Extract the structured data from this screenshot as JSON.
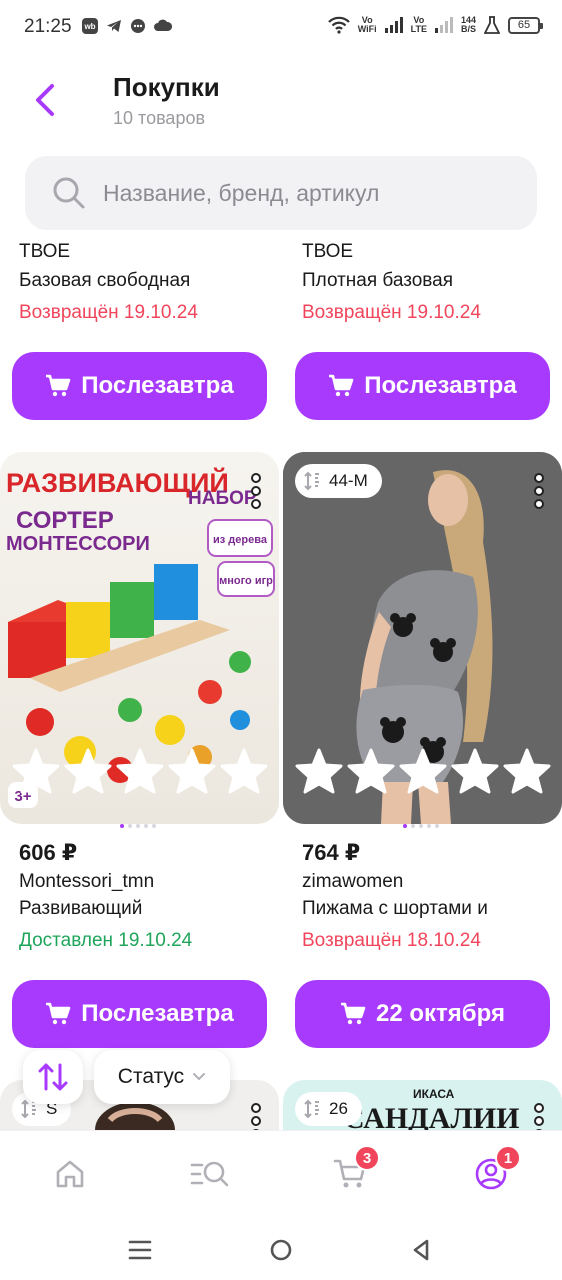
{
  "status_bar": {
    "time": "21:25",
    "apps": [
      "wb",
      "telegram-icon",
      "chat-icon",
      "cloud-icon"
    ],
    "vo_wifi": "Vo\nWiFi",
    "vo_lte": "Vo\nLTE",
    "net_speed_value": "144",
    "net_speed_unit": "B/S",
    "battery": "65"
  },
  "header": {
    "title": "Покупки",
    "subtitle": "10 товаров"
  },
  "search": {
    "placeholder": "Название, бренд, артикул"
  },
  "products": [
    {
      "brand_partial": "ТВОЕ",
      "name": "Базовая свободная",
      "status": "Возвращён 19.10.24",
      "status_type": "returned",
      "button": "Послезавтра"
    },
    {
      "brand_partial": "ТВОЕ",
      "name": "Плотная базовая",
      "status": "Возвращён 19.10.24",
      "status_type": "returned",
      "button": "Послезавтра"
    },
    {
      "image_text": {
        "line1": "РАЗВИВАЮЩИЙ",
        "line2": "НАБОР",
        "line3": "СОРТЕР",
        "line4": "МОНТЕССОРИ",
        "tag1": "из дерева",
        "tag2": "много игр",
        "age": "3+"
      },
      "price": "606 ₽",
      "brand": "Montessori_tmn",
      "name": "Развивающий",
      "status": "Доставлен 19.10.24",
      "status_type": "delivered",
      "button": "Послезавтра",
      "rating_stars": 5
    },
    {
      "size": "44-M",
      "price": "764 ₽",
      "brand": "zimawomen",
      "name": "Пижама с шортами и",
      "status": "Возвращён 18.10.24",
      "status_type": "returned",
      "button": "22 октября",
      "rating_stars": 5
    },
    {
      "size": "S"
    },
    {
      "size": "26",
      "image_text": {
        "logo": "ИКАСА",
        "title": "САНДАЛИИ"
      }
    }
  ],
  "filters": {
    "status_label": "Статус"
  },
  "bottom_nav": {
    "items": [
      "home-icon",
      "catalog-search-icon",
      "cart-icon",
      "profile-icon"
    ],
    "cart_badge": "3",
    "profile_badge": "1"
  },
  "colors": {
    "accent": "#a73afd",
    "returned": "#f0455b",
    "delivered": "#1fa55a"
  }
}
